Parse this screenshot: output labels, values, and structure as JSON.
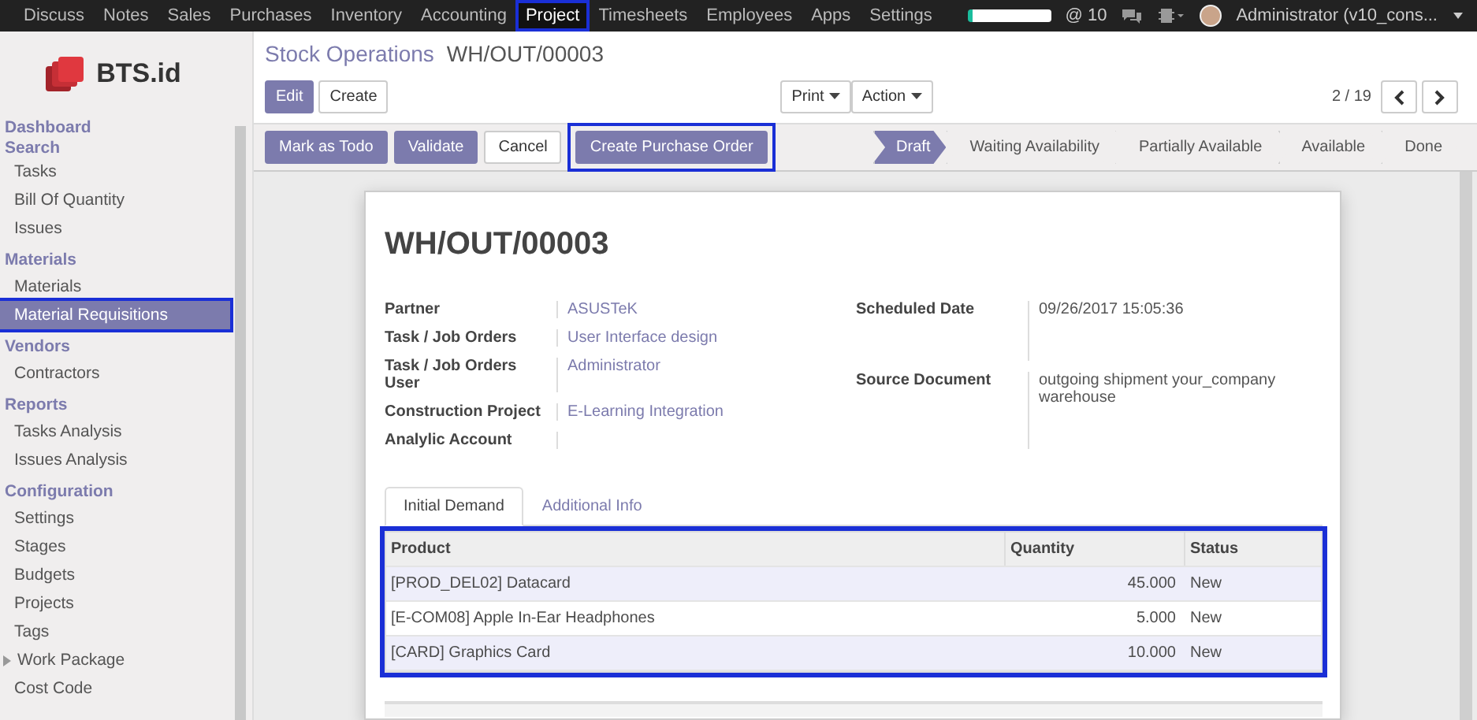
{
  "topbar": {
    "apps": [
      {
        "label": "Discuss",
        "selected": false,
        "highlighted": false
      },
      {
        "label": "Notes",
        "selected": false,
        "highlighted": false
      },
      {
        "label": "Sales",
        "selected": false,
        "highlighted": false
      },
      {
        "label": "Purchases",
        "selected": false,
        "highlighted": false
      },
      {
        "label": "Inventory",
        "selected": false,
        "highlighted": false
      },
      {
        "label": "Accounting",
        "selected": false,
        "highlighted": false
      },
      {
        "label": "Project",
        "selected": true,
        "highlighted": true
      },
      {
        "label": "Timesheets",
        "selected": false,
        "highlighted": false
      },
      {
        "label": "Employees",
        "selected": false,
        "highlighted": false
      },
      {
        "label": "Apps",
        "selected": false,
        "highlighted": false
      },
      {
        "label": "Settings",
        "selected": false,
        "highlighted": false
      }
    ],
    "notifications": "@ 10",
    "user": "Administrator (v10_cons..."
  },
  "logo": {
    "text": "BTS.id"
  },
  "sidebar": {
    "sections": [
      {
        "header": "Dashboard"
      },
      {
        "header": "Search",
        "items": [
          {
            "label": "Tasks",
            "selected": false,
            "highlighted": false,
            "expandable": false
          },
          {
            "label": "Bill Of Quantity",
            "selected": false,
            "highlighted": false,
            "expandable": false
          },
          {
            "label": "Issues",
            "selected": false,
            "highlighted": false,
            "expandable": false
          }
        ]
      },
      {
        "header": "Materials",
        "items": [
          {
            "label": "Materials",
            "selected": false,
            "highlighted": false,
            "expandable": false
          },
          {
            "label": "Material Requisitions",
            "selected": true,
            "highlighted": true,
            "expandable": false
          }
        ]
      },
      {
        "header": "Vendors",
        "items": [
          {
            "label": "Contractors",
            "selected": false,
            "highlighted": false,
            "expandable": false
          }
        ]
      },
      {
        "header": "Reports",
        "items": [
          {
            "label": "Tasks Analysis",
            "selected": false,
            "highlighted": false,
            "expandable": false
          },
          {
            "label": "Issues Analysis",
            "selected": false,
            "highlighted": false,
            "expandable": false
          }
        ]
      },
      {
        "header": "Configuration",
        "items": [
          {
            "label": "Settings",
            "selected": false,
            "highlighted": false,
            "expandable": false
          },
          {
            "label": "Stages",
            "selected": false,
            "highlighted": false,
            "expandable": false
          },
          {
            "label": "Budgets",
            "selected": false,
            "highlighted": false,
            "expandable": false
          },
          {
            "label": "Projects",
            "selected": false,
            "highlighted": false,
            "expandable": false
          },
          {
            "label": "Tags",
            "selected": false,
            "highlighted": false,
            "expandable": false
          },
          {
            "label": "Work Package",
            "selected": false,
            "highlighted": false,
            "expandable": true
          },
          {
            "label": "Cost Code",
            "selected": false,
            "highlighted": false,
            "expandable": false
          }
        ]
      }
    ]
  },
  "breadcrumb": [
    "Stock Operations",
    "WH/OUT/00003"
  ],
  "control_buttons": [
    {
      "label": "Edit",
      "kind": "primary"
    },
    {
      "label": "Create",
      "kind": "default"
    }
  ],
  "dropdowns": [
    "Print",
    "Action"
  ],
  "pager": "2 / 19",
  "action_buttons": [
    {
      "label": "Mark as Todo",
      "kind": "primary",
      "highlighted": false
    },
    {
      "label": "Validate",
      "kind": "primary",
      "highlighted": false
    },
    {
      "label": "Cancel",
      "kind": "default",
      "highlighted": false
    },
    {
      "label": "Create Purchase Order",
      "kind": "primary",
      "highlighted": true
    }
  ],
  "stages": [
    {
      "label": "Draft",
      "selected": true
    },
    {
      "label": "Waiting Availability",
      "selected": false
    },
    {
      "label": "Partially Available",
      "selected": false
    },
    {
      "label": "Available",
      "selected": false
    },
    {
      "label": "Done",
      "selected": false
    }
  ],
  "sheet": {
    "title": "WH/OUT/00003",
    "left_fields": [
      {
        "label": "Partner",
        "value": "ASUSTeK"
      },
      {
        "label": "Task / Job Orders",
        "value": "User Interface design"
      },
      {
        "label": "Task / Job Orders User",
        "value": "Administrator"
      },
      {
        "label": "Construction Project",
        "value": "E-Learning Integration"
      },
      {
        "label": "Analylic Account"
      }
    ],
    "right_fields": [
      {
        "label": "Scheduled Date",
        "value": "09/26/2017 15:05:36"
      },
      {
        "label": "Source Document",
        "value": "outgoing shipment your_company warehouse"
      }
    ],
    "tabs": [
      {
        "label": "Initial Demand",
        "selected": true
      },
      {
        "label": "Additional Info",
        "selected": false
      }
    ],
    "table": {
      "highlighted": true,
      "columns": [
        "Product",
        "Quantity",
        "Status"
      ],
      "rows": [
        [
          "[PROD_DEL02] Datacard",
          "45.000",
          "New"
        ],
        [
          "[E-COM08] Apple In-Ear Headphones",
          "5.000",
          "New"
        ],
        [
          "[CARD] Graphics Card",
          "10.000",
          "New"
        ]
      ]
    }
  }
}
